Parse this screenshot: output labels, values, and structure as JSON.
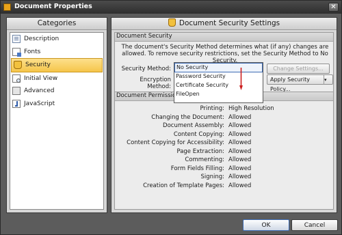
{
  "window": {
    "title": "Document Properties"
  },
  "categories": {
    "header": "Categories",
    "items": [
      {
        "label": "Description",
        "icon": "description-icon"
      },
      {
        "label": "Fonts",
        "icon": "fonts-icon"
      },
      {
        "label": "Security",
        "icon": "security-icon",
        "selected": true
      },
      {
        "label": "Initial View",
        "icon": "initial-view-icon"
      },
      {
        "label": "Advanced",
        "icon": "advanced-icon"
      },
      {
        "label": "JavaScript",
        "icon": "javascript-icon"
      }
    ]
  },
  "security": {
    "header": "Document Security Settings",
    "group_title": "Document Security",
    "description": "The document's Security Method determines what (if any) changes are allowed. To remove security restrictions, set the Security Method to No Security.",
    "method_label": "Security Method:",
    "encryption_label": "Encryption Method:",
    "change_settings": "Change Settings...",
    "apply_policy": "Apply Security Policy...",
    "dropdown_options": [
      "No Security",
      "Password Security",
      "Certificate Security",
      "FileOpen"
    ],
    "selected_option": "No Security"
  },
  "permissions": {
    "group_title": "Document Permissions Deta",
    "rows": [
      {
        "key": "Printing:",
        "value": "High Resolution"
      },
      {
        "key": "Changing the Document:",
        "value": "Allowed"
      },
      {
        "key": "Document Assembly:",
        "value": "Allowed"
      },
      {
        "key": "Content Copying:",
        "value": "Allowed"
      },
      {
        "key": "Content Copying for Accessibility:",
        "value": "Allowed"
      },
      {
        "key": "Page Extraction:",
        "value": "Allowed"
      },
      {
        "key": "Commenting:",
        "value": "Allowed"
      },
      {
        "key": "Form Fields Filling:",
        "value": "Allowed"
      },
      {
        "key": "Signing:",
        "value": "Allowed"
      },
      {
        "key": "Creation of Template Pages:",
        "value": "Allowed"
      }
    ]
  },
  "footer": {
    "ok": "OK",
    "cancel": "Cancel"
  },
  "colors": {
    "selection": "#f5c54a",
    "accent_red": "#cc1f1f",
    "focus_blue": "#3d6bb3"
  }
}
